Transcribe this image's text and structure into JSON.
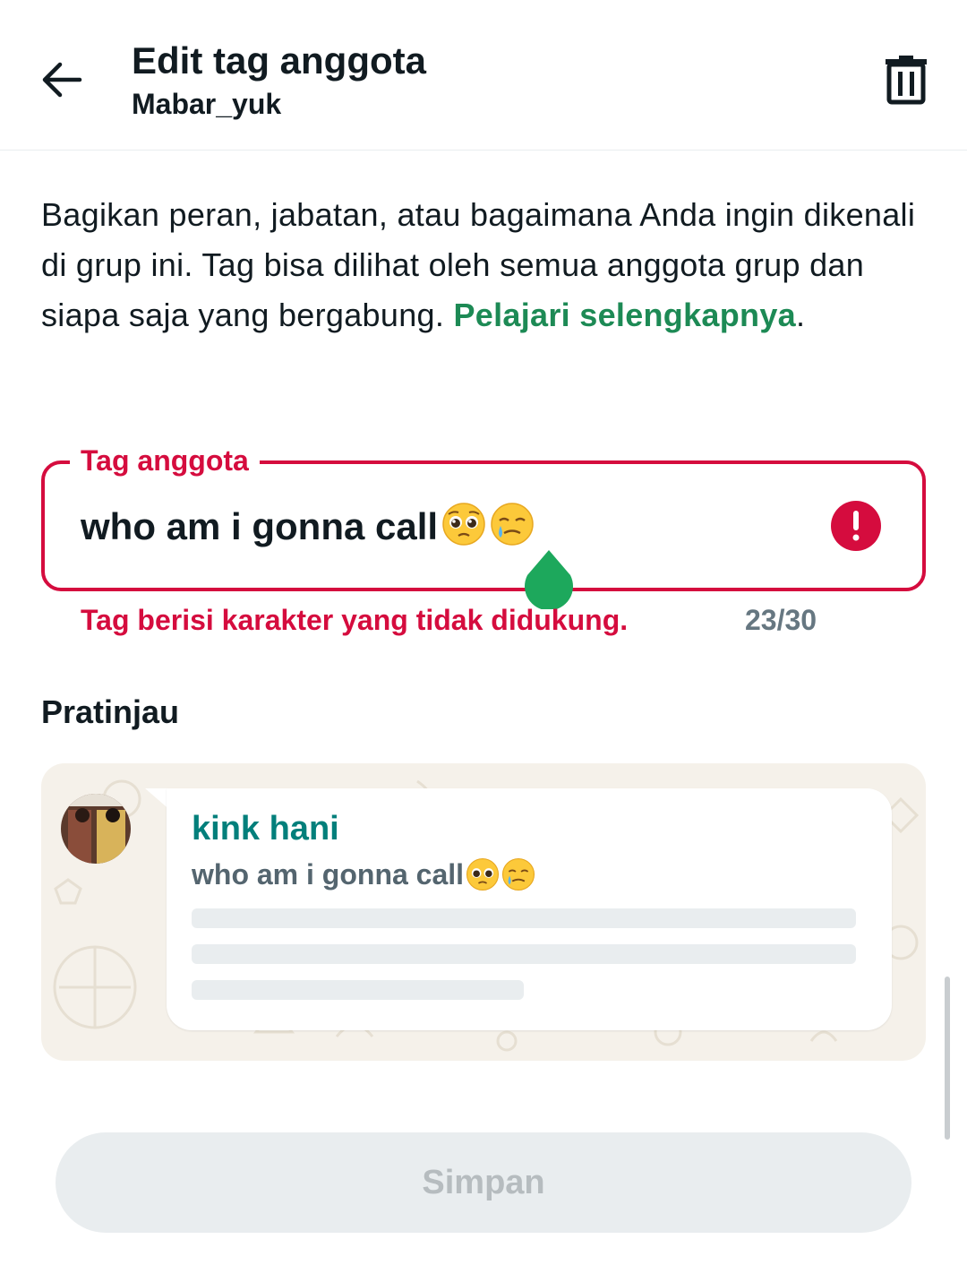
{
  "header": {
    "title": "Edit tag anggota",
    "subtitle": "Mabar_yuk",
    "back_icon": "arrow-left-icon",
    "delete_icon": "trash-icon"
  },
  "description": {
    "text": "Bagikan peran, jabatan, atau bagaimana Anda ingin dikenali di grup ini. Tag bisa dilihat oleh semua anggota grup dan siapa saja yang bergabung. ",
    "link": "Pelajari selengkapnya",
    "trailing": "."
  },
  "field": {
    "label": "Tag anggota",
    "value": "who am i gonna call",
    "emojis": [
      "pleading-face-emoji",
      "smiling-face-with-tear-emoji"
    ],
    "error": "Tag berisi karakter yang tidak didukung.",
    "counter": "23/30"
  },
  "preview": {
    "title": "Pratinjau",
    "name": "kink hani",
    "tag": "who am i gonna call"
  },
  "save_label": "Simpan",
  "colors": {
    "error": "#d50c3e",
    "link": "#1d8a55",
    "name": "#027f7b",
    "preview_bg": "#f5f1ea"
  }
}
